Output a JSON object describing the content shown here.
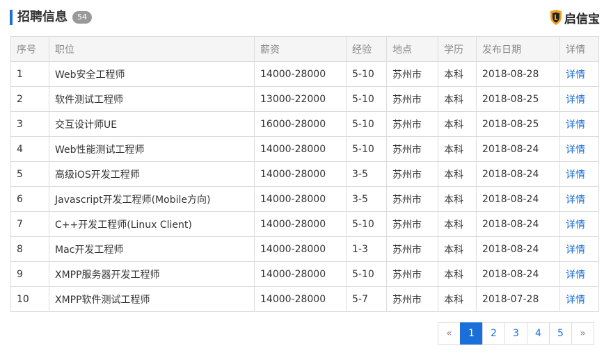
{
  "header": {
    "title": "招聘信息",
    "count": "54",
    "brand_name": "启信宝",
    "brand_icon": "shield-logo-icon",
    "accent_color": "#1a6fd8"
  },
  "table": {
    "columns": [
      "序号",
      "职位",
      "薪资",
      "经验",
      "地点",
      "学历",
      "发布日期",
      "详情"
    ],
    "rows": [
      {
        "no": "1",
        "position": "Web安全工程师",
        "salary": "14000-28000",
        "experience": "5-10",
        "location": "苏州市",
        "education": "本科",
        "date": "2018-08-28",
        "detail": "详情"
      },
      {
        "no": "2",
        "position": "软件测试工程师",
        "salary": "13000-22000",
        "experience": "5-10",
        "location": "苏州市",
        "education": "本科",
        "date": "2018-08-25",
        "detail": "详情"
      },
      {
        "no": "3",
        "position": "交互设计师UE",
        "salary": "16000-28000",
        "experience": "5-10",
        "location": "苏州市",
        "education": "本科",
        "date": "2018-08-25",
        "detail": "详情"
      },
      {
        "no": "4",
        "position": "Web性能测试工程师",
        "salary": "14000-28000",
        "experience": "5-10",
        "location": "苏州市",
        "education": "本科",
        "date": "2018-08-24",
        "detail": "详情"
      },
      {
        "no": "5",
        "position": "高级iOS开发工程师",
        "salary": "14000-28000",
        "experience": "3-5",
        "location": "苏州市",
        "education": "本科",
        "date": "2018-08-24",
        "detail": "详情"
      },
      {
        "no": "6",
        "position": "Javascript开发工程师(Mobile方向)",
        "salary": "14000-28000",
        "experience": "3-5",
        "location": "苏州市",
        "education": "本科",
        "date": "2018-08-24",
        "detail": "详情"
      },
      {
        "no": "7",
        "position": "C++开发工程师(Linux Client)",
        "salary": "14000-28000",
        "experience": "5-10",
        "location": "苏州市",
        "education": "本科",
        "date": "2018-08-24",
        "detail": "详情"
      },
      {
        "no": "8",
        "position": "Mac开发工程师",
        "salary": "14000-28000",
        "experience": "1-3",
        "location": "苏州市",
        "education": "本科",
        "date": "2018-08-24",
        "detail": "详情"
      },
      {
        "no": "9",
        "position": "XMPP服务器开发工程师",
        "salary": "14000-28000",
        "experience": "5-10",
        "location": "苏州市",
        "education": "本科",
        "date": "2018-08-24",
        "detail": "详情"
      },
      {
        "no": "10",
        "position": "XMPP软件测试工程师",
        "salary": "14000-28000",
        "experience": "5-7",
        "location": "苏州市",
        "education": "本科",
        "date": "2018-07-28",
        "detail": "详情"
      }
    ]
  },
  "pagination": {
    "prev": "«",
    "pages": [
      "1",
      "2",
      "3",
      "4",
      "5"
    ],
    "current": "1",
    "next": "»"
  }
}
